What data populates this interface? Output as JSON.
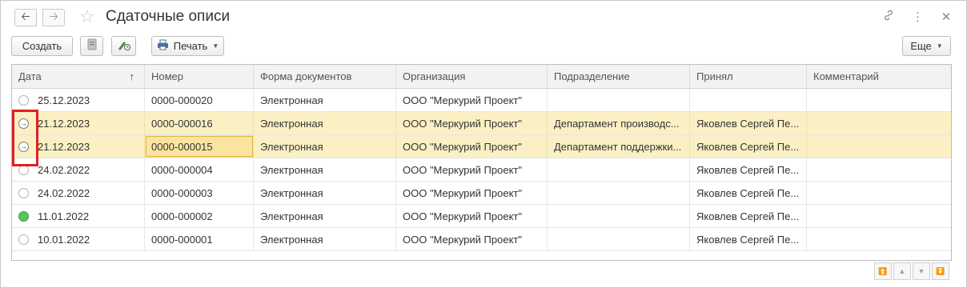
{
  "window": {
    "title": "Сдаточные описи",
    "back_icon": "arrow-left-icon",
    "forward_icon": "arrow-right-icon",
    "favorite_icon": "star-icon",
    "link_icon": "link-icon",
    "menu_icon": "more-vertical-icon",
    "close_icon": "close-icon"
  },
  "toolbar": {
    "create_label": "Создать",
    "print_label": "Печать",
    "more_label": "Еще"
  },
  "table": {
    "columns": [
      "Дата",
      "Номер",
      "Форма документов",
      "Организация",
      "Подразделение",
      "Принял",
      "Комментарий"
    ],
    "sort_indicator": "↑",
    "rows": [
      {
        "status": "empty",
        "date": "25.12.2023",
        "number": "0000-000020",
        "form": "Электронная",
        "org": "ООО \"Меркурий Проект\"",
        "dept": "",
        "accepted": "",
        "comment": ""
      },
      {
        "status": "posted",
        "date": "21.12.2023",
        "number": "0000-000016",
        "form": "Электронная",
        "org": "ООО \"Меркурий Проект\"",
        "dept": "Департамент производс...",
        "accepted": "Яковлев Сергей Пе...",
        "comment": ""
      },
      {
        "status": "posted",
        "date": "21.12.2023",
        "number": "0000-000015",
        "form": "Электронная",
        "org": "ООО \"Меркурий Проект\"",
        "dept": "Департамент поддержки...",
        "accepted": "Яковлев Сергей Пе...",
        "comment": ""
      },
      {
        "status": "empty",
        "date": "24.02.2022",
        "number": "0000-000004",
        "form": "Электронная",
        "org": "ООО \"Меркурий Проект\"",
        "dept": "",
        "accepted": "Яковлев Сергей Пе...",
        "comment": ""
      },
      {
        "status": "empty",
        "date": "24.02.2022",
        "number": "0000-000003",
        "form": "Электронная",
        "org": "ООО \"Меркурий Проект\"",
        "dept": "",
        "accepted": "Яковлев Сергей Пе...",
        "comment": ""
      },
      {
        "status": "green",
        "date": "11.01.2022",
        "number": "0000-000002",
        "form": "Электронная",
        "org": "ООО \"Меркурий Проект\"",
        "dept": "",
        "accepted": "Яковлев Сергей Пе...",
        "comment": ""
      },
      {
        "status": "empty",
        "date": "10.01.2022",
        "number": "0000-000001",
        "form": "Электронная",
        "org": "ООО \"Меркурий Проект\"",
        "dept": "",
        "accepted": "Яковлев Сергей Пе...",
        "comment": ""
      }
    ]
  },
  "colors": {
    "highlight_row": "#fbf0c4",
    "focus_cell": "#fbe4a0",
    "status_green": "#5cc35a",
    "annotation_red": "#e02020"
  }
}
